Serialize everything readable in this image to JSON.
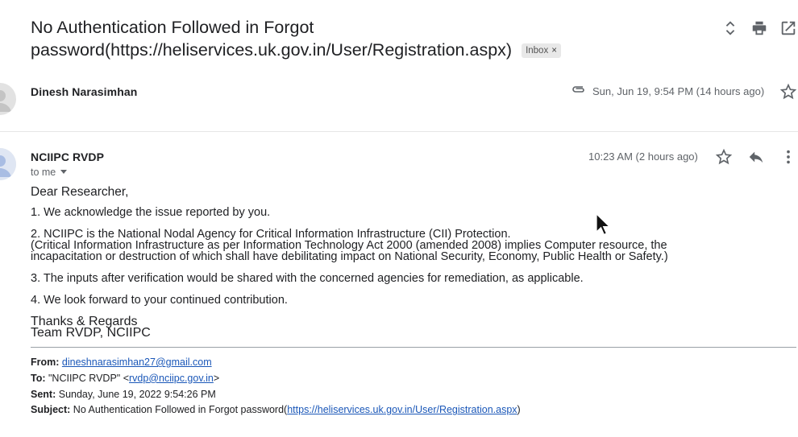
{
  "subject": {
    "line1": "No Authentication Followed in Forgot",
    "line2": "password(https://heliservices.uk.gov.in/User/Registration.aspx)",
    "label_chip": "Inbox",
    "chip_close": "×"
  },
  "toolbar_icons": [
    "expand-collapse-icon",
    "print-icon",
    "open-in-new-window-icon"
  ],
  "message1": {
    "sender": "Dinesh Narasimhan",
    "date": "Sun, Jun 19, 9:54 PM (14 hours ago)",
    "has_attachment": true
  },
  "message2": {
    "sender": "NCIIPC RVDP",
    "recipient": "to me",
    "date": "10:23 AM (2 hours ago)",
    "body": {
      "greeting": "Dear Researcher,",
      "p1": "1. We acknowledge the issue reported by you.",
      "p2a": "2. NCIIPC is the National Nodal Agency for Critical Information Infrastructure (CII) Protection.",
      "p2b": "(Critical Information Infrastructure as per Information Technology Act 2000 (amended 2008) implies Computer resource, the",
      "p2c": "incapacitation or destruction of which shall have debilitating impact on National Security, Economy, Public Health or Safety.)",
      "p3": "3. The inputs after verification would be shared with the concerned agencies for remediation, as applicable.",
      "p4": "4. We look forward to your continued contribution.",
      "signoff1": "Thanks & Regards",
      "signoff2": "Team RVDP, NCIIPC"
    },
    "quoted": {
      "from_label": "From:",
      "from_email": "dineshnarasimhan27@gmail.com",
      "to_label": "To:",
      "to_name": "\"NCIIPC RVDP\" <",
      "to_email": "rvdp@nciipc.gov.in",
      "to_close": ">",
      "sent_label": "Sent:",
      "sent_value": "Sunday, June 19, 2022 9:54:26 PM",
      "subject_label": "Subject:",
      "subject_prefix": "No Authentication Followed in Forgot password(",
      "subject_link": "https://heliservices.uk.gov.in/User/Registration.aspx",
      "subject_suffix": ")"
    }
  }
}
